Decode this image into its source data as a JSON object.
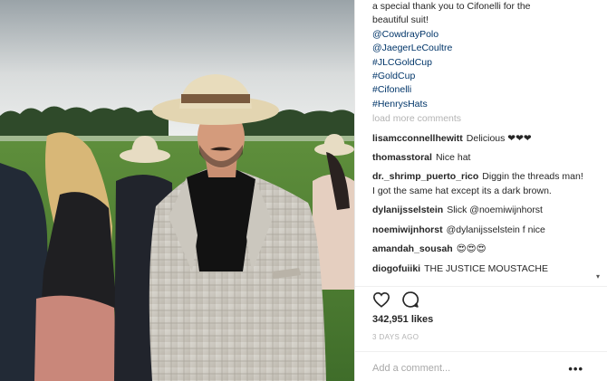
{
  "caption": [
    "a special thank you to Cifonelli for the",
    "beautiful suit!",
    "@CowdrayPolo",
    "@JaegerLeCoultre",
    "#JLCGoldCup",
    "#GoldCup",
    "#Cifonelli",
    "#HenrysHats"
  ],
  "load_more": "load more comments",
  "comments": [
    {
      "user": "lisamcconnellhewitt",
      "text": "Delicious ❤❤❤"
    },
    {
      "user": "thomasstoral",
      "text": "Nice hat"
    },
    {
      "user": "dr._shrimp_puerto_rico",
      "text": "Diggin the threads man! I got the same hat except its a dark brown."
    },
    {
      "user": "dylanijsselstein",
      "text": "Slick @noemiwijnhorst"
    },
    {
      "user": "noemiwijnhorst",
      "text": "@dylanijsselstein f nice"
    },
    {
      "user": "amandah_sousah",
      "text": "😍😍😍"
    },
    {
      "user": "diogofuiiki",
      "text": "THE JUSTICE MOUSTACHE"
    }
  ],
  "icons": {
    "like": "heart-outline-icon",
    "comment": "comment-bubble-icon",
    "more": "more-options-icon",
    "scroll": "scroll-down-arrow-icon"
  },
  "likes": "342,951 likes",
  "time": "3 DAYS AGO",
  "add_comment_placeholder": "Add a comment...",
  "more_label": "•••",
  "scroll_arrow": "▾",
  "colors": {
    "link": "#003569",
    "muted": "#b3b3b3",
    "text": "#262626"
  }
}
